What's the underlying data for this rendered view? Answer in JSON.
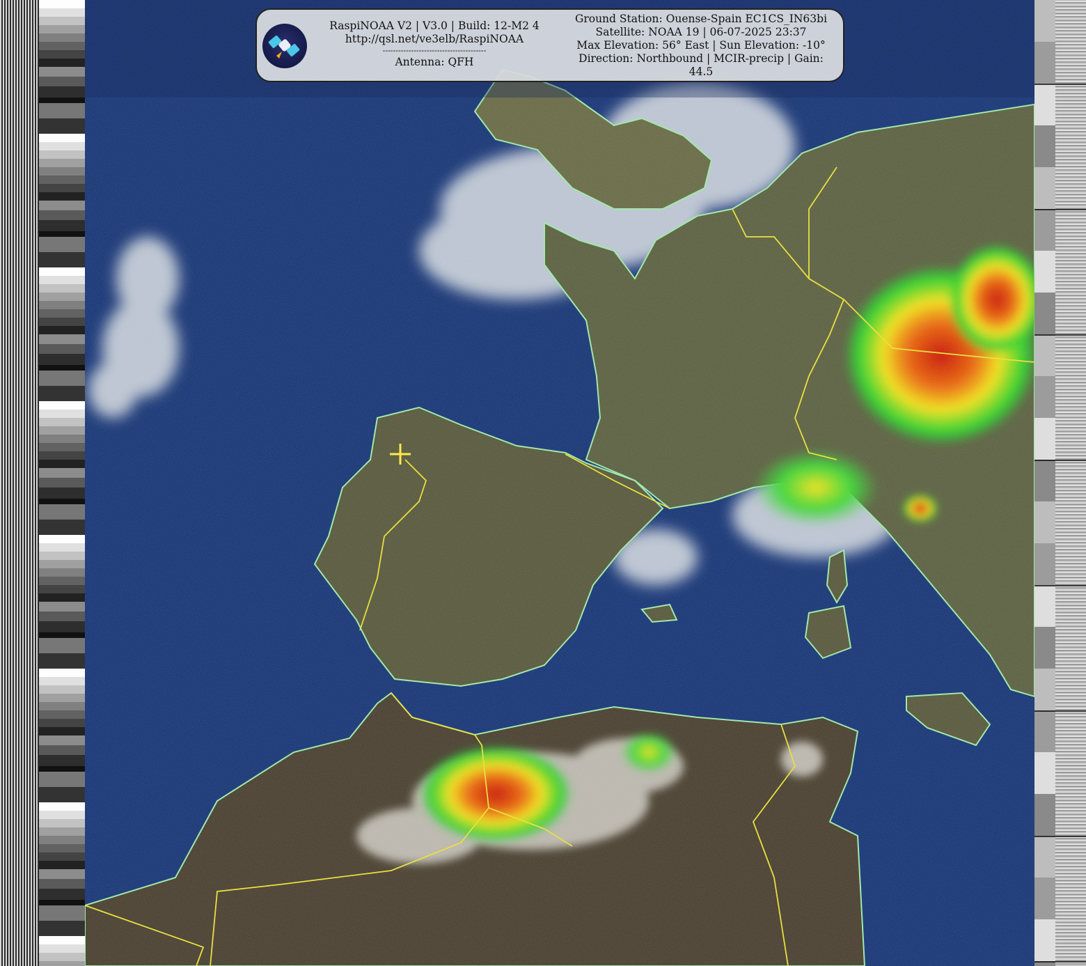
{
  "header": {
    "software": "RaspiNOAA V2 | V3.0 | Build: 12-M2 4",
    "url": "http://qsl.net/ve3elb/RaspiNOAA",
    "separator": "----------------------------------------",
    "antenna": "Antenna: QFH",
    "ground_station": "Ground Station: Ouense-Spain EC1CS_IN63bi",
    "satellite": "Satellite: NOAA 19 | 06-07-2025 23:37",
    "elevation": "Max Elevation: 56° East | Sun Elevation: -10°",
    "direction": "Direction: Northbound | MCIR-precip | Gain:",
    "gain": "44.5"
  },
  "logo": {
    "icon": "satellite-icon"
  },
  "map": {
    "marker": "ground-station-crosshair",
    "colors": {
      "ocean": "#1d3a78",
      "land": "#5f6445",
      "desert": "#5c4f3a",
      "cloud": "#d8dde0",
      "coastline": "#9ee8a8",
      "border": "#e8df3a",
      "precip_low": "#2fd12f",
      "precip_mid": "#f0e020",
      "precip_high": "#d42a10"
    }
  }
}
